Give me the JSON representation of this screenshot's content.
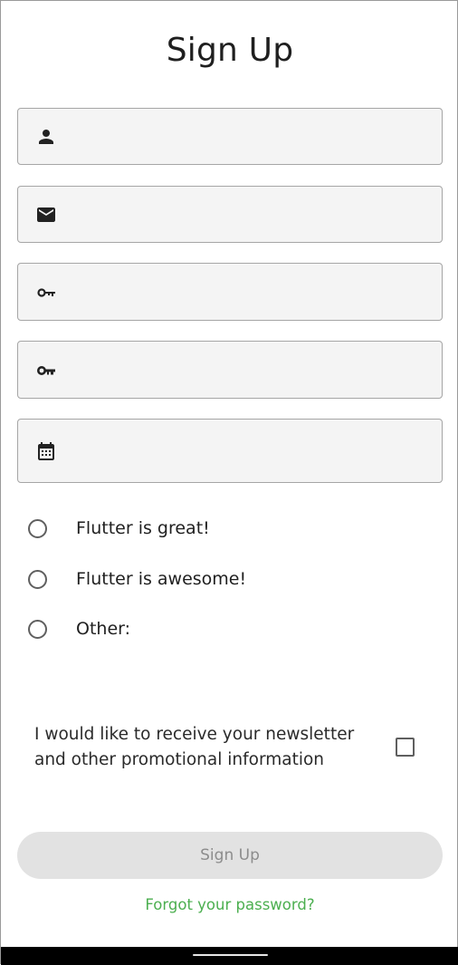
{
  "page": {
    "title": "Sign Up"
  },
  "form": {
    "name_field": {
      "value": "",
      "icon": "person-icon"
    },
    "email_field": {
      "value": "",
      "icon": "email-icon"
    },
    "password_field": {
      "value": "",
      "icon": "key-icon"
    },
    "confirm_password_field": {
      "value": "",
      "icon": "key-icon"
    },
    "birthdate_field": {
      "value": "",
      "icon": "calendar-icon"
    }
  },
  "radios": [
    {
      "label": "Flutter is great!",
      "selected": false
    },
    {
      "label": "Flutter is awesome!",
      "selected": false
    },
    {
      "label": "Other:",
      "selected": false
    }
  ],
  "newsletter": {
    "label_line1": "I would like to receive your newsletter",
    "label_line2": "and other promotional information",
    "checked": false
  },
  "buttons": {
    "signup_label": "Sign Up",
    "forgot_label": "Forgot your password?"
  },
  "colors": {
    "link": "#4caf50",
    "field_bg": "#f4f4f4",
    "button_disabled_bg": "#e2e2e2",
    "button_disabled_text": "#8c8c8c"
  }
}
